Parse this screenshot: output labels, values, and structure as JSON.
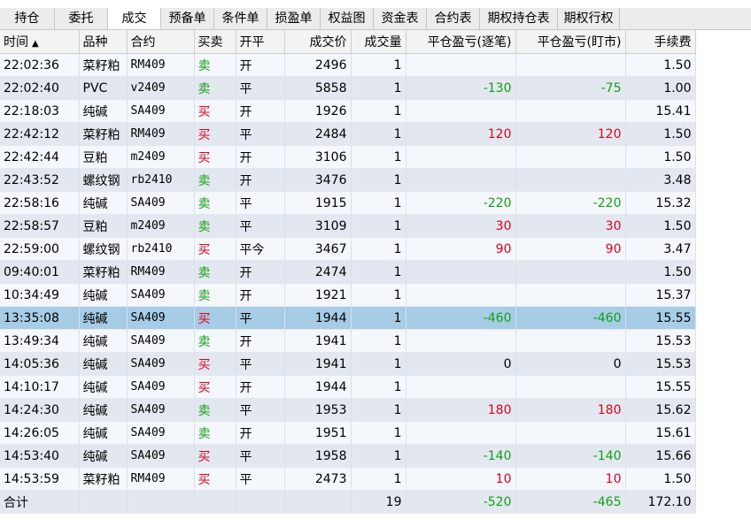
{
  "tabs": [
    {
      "label": "持仓",
      "active": false
    },
    {
      "label": "委托",
      "active": false
    },
    {
      "label": "成交",
      "active": true
    },
    {
      "label": "预备单",
      "active": false
    },
    {
      "label": "条件单",
      "active": false
    },
    {
      "label": "损盈单",
      "active": false
    },
    {
      "label": "权益图",
      "active": false
    },
    {
      "label": "资金表",
      "active": false
    },
    {
      "label": "合约表",
      "active": false
    },
    {
      "label": "期权持仓表",
      "active": false
    },
    {
      "label": "期权行权",
      "active": false
    }
  ],
  "columns": {
    "time": "时间",
    "sort_icon": "▲",
    "product": "品种",
    "contract": "合约",
    "side": "买卖",
    "openclose": "开平",
    "price": "成交价",
    "qty": "成交量",
    "pnl_trade": "平仓盈亏(逐笔)",
    "pnl_daily": "平仓盈亏(盯市)",
    "fee": "手续费"
  },
  "rows": [
    {
      "time": "22:02:36",
      "product": "菜籽粕",
      "contract": "RM409",
      "side": "卖",
      "openclose": "开",
      "price": "2496",
      "qty": "1",
      "pnl_trade": "",
      "pnl_daily": "",
      "fee": "1.50"
    },
    {
      "time": "22:02:40",
      "product": "PVC",
      "contract": "v2409",
      "side": "卖",
      "openclose": "平",
      "price": "5858",
      "qty": "1",
      "pnl_trade": "-130",
      "pnl_daily": "-75",
      "fee": "1.00"
    },
    {
      "time": "22:18:03",
      "product": "纯碱",
      "contract": "SA409",
      "side": "买",
      "openclose": "开",
      "price": "1926",
      "qty": "1",
      "pnl_trade": "",
      "pnl_daily": "",
      "fee": "15.41"
    },
    {
      "time": "22:42:12",
      "product": "菜籽粕",
      "contract": "RM409",
      "side": "买",
      "openclose": "平",
      "price": "2484",
      "qty": "1",
      "pnl_trade": "120",
      "pnl_daily": "120",
      "fee": "1.50"
    },
    {
      "time": "22:42:44",
      "product": "豆粕",
      "contract": "m2409",
      "side": "买",
      "openclose": "开",
      "price": "3106",
      "qty": "1",
      "pnl_trade": "",
      "pnl_daily": "",
      "fee": "1.50"
    },
    {
      "time": "22:43:52",
      "product": "螺纹钢",
      "contract": "rb2410",
      "side": "卖",
      "openclose": "开",
      "price": "3476",
      "qty": "1",
      "pnl_trade": "",
      "pnl_daily": "",
      "fee": "3.48"
    },
    {
      "time": "22:58:16",
      "product": "纯碱",
      "contract": "SA409",
      "side": "卖",
      "openclose": "平",
      "price": "1915",
      "qty": "1",
      "pnl_trade": "-220",
      "pnl_daily": "-220",
      "fee": "15.32"
    },
    {
      "time": "22:58:57",
      "product": "豆粕",
      "contract": "m2409",
      "side": "卖",
      "openclose": "平",
      "price": "3109",
      "qty": "1",
      "pnl_trade": "30",
      "pnl_daily": "30",
      "fee": "1.50"
    },
    {
      "time": "22:59:00",
      "product": "螺纹钢",
      "contract": "rb2410",
      "side": "买",
      "openclose": "平今",
      "price": "3467",
      "qty": "1",
      "pnl_trade": "90",
      "pnl_daily": "90",
      "fee": "3.47"
    },
    {
      "time": "09:40:01",
      "product": "菜籽粕",
      "contract": "RM409",
      "side": "卖",
      "openclose": "开",
      "price": "2474",
      "qty": "1",
      "pnl_trade": "",
      "pnl_daily": "",
      "fee": "1.50"
    },
    {
      "time": "10:34:49",
      "product": "纯碱",
      "contract": "SA409",
      "side": "卖",
      "openclose": "开",
      "price": "1921",
      "qty": "1",
      "pnl_trade": "",
      "pnl_daily": "",
      "fee": "15.37"
    },
    {
      "time": "13:35:08",
      "product": "纯碱",
      "contract": "SA409",
      "side": "买",
      "openclose": "平",
      "price": "1944",
      "qty": "1",
      "pnl_trade": "-460",
      "pnl_daily": "-460",
      "fee": "15.55",
      "selected": true
    },
    {
      "time": "13:49:34",
      "product": "纯碱",
      "contract": "SA409",
      "side": "卖",
      "openclose": "开",
      "price": "1941",
      "qty": "1",
      "pnl_trade": "",
      "pnl_daily": "",
      "fee": "15.53"
    },
    {
      "time": "14:05:36",
      "product": "纯碱",
      "contract": "SA409",
      "side": "买",
      "openclose": "平",
      "price": "1941",
      "qty": "1",
      "pnl_trade": "0",
      "pnl_daily": "0",
      "fee": "15.53"
    },
    {
      "time": "14:10:17",
      "product": "纯碱",
      "contract": "SA409",
      "side": "买",
      "openclose": "开",
      "price": "1944",
      "qty": "1",
      "pnl_trade": "",
      "pnl_daily": "",
      "fee": "15.55"
    },
    {
      "time": "14:24:30",
      "product": "纯碱",
      "contract": "SA409",
      "side": "卖",
      "openclose": "平",
      "price": "1953",
      "qty": "1",
      "pnl_trade": "180",
      "pnl_daily": "180",
      "fee": "15.62"
    },
    {
      "time": "14:26:05",
      "product": "纯碱",
      "contract": "SA409",
      "side": "卖",
      "openclose": "开",
      "price": "1951",
      "qty": "1",
      "pnl_trade": "",
      "pnl_daily": "",
      "fee": "15.61"
    },
    {
      "time": "14:53:40",
      "product": "纯碱",
      "contract": "SA409",
      "side": "买",
      "openclose": "平",
      "price": "1958",
      "qty": "1",
      "pnl_trade": "-140",
      "pnl_daily": "-140",
      "fee": "15.66"
    },
    {
      "time": "14:53:59",
      "product": "菜籽粕",
      "contract": "RM409",
      "side": "买",
      "openclose": "平",
      "price": "2473",
      "qty": "1",
      "pnl_trade": "10",
      "pnl_daily": "10",
      "fee": "1.50"
    }
  ],
  "totals": {
    "label": "合计",
    "qty": "19",
    "pnl_trade": "-520",
    "pnl_daily": "-465",
    "fee": "172.10"
  },
  "colors": {
    "profit": "#e0001b",
    "loss": "#12a012",
    "selected_row": "#a6cce6"
  }
}
